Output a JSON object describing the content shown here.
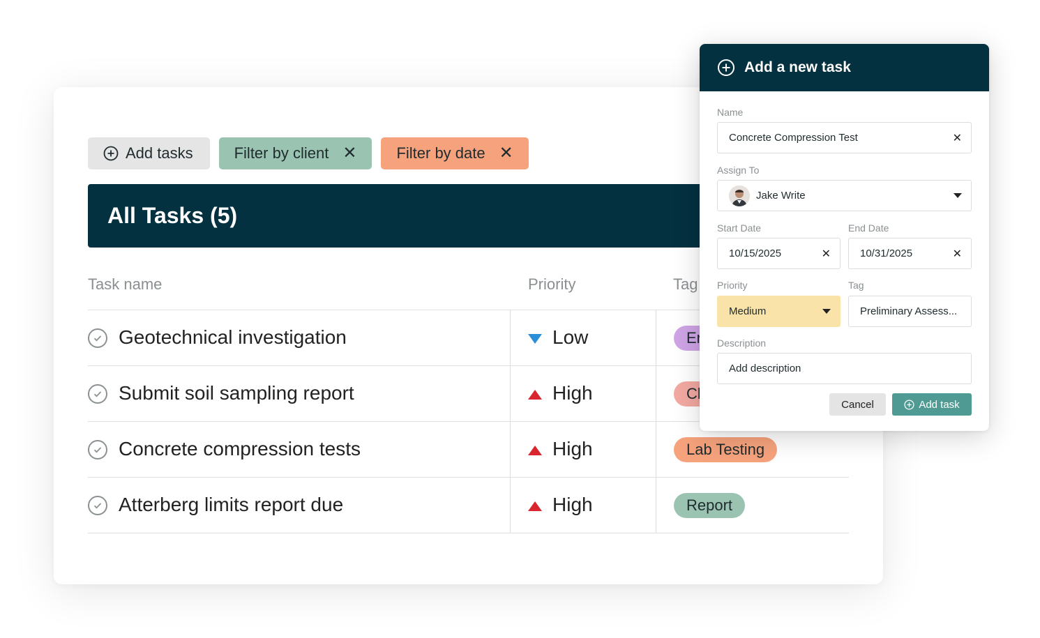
{
  "toolbar": {
    "add_tasks": "Add tasks",
    "filter_client": "Filter by client",
    "filter_date": "Filter by date",
    "remove_symbol": "✕"
  },
  "banner": {
    "title": "All Tasks (5)"
  },
  "columns": {
    "task_name": "Task name",
    "priority": "Priority",
    "tag": "Tag"
  },
  "rows": [
    {
      "name": "Geotechnical investigation",
      "priority": "Low",
      "priority_icon": "triangle-down-icon",
      "tag": "Er",
      "tag_color": "#cfa4e6"
    },
    {
      "name": "Submit soil sampling report",
      "priority": "High",
      "priority_icon": "triangle-up-icon",
      "tag": "Cl",
      "tag_color": "#f3a9a2"
    },
    {
      "name": "Concrete compression tests",
      "priority": "High",
      "priority_icon": "triangle-up-icon",
      "tag": "Lab Testing",
      "tag_color": "#f6a27c"
    },
    {
      "name": "Atterberg limits report due",
      "priority": "High",
      "priority_icon": "triangle-up-icon",
      "tag": "Report",
      "tag_color": "#9ac4b1"
    }
  ],
  "modal": {
    "title": "Add a new task",
    "name_label": "Name",
    "name_value": "Concrete Compression Test",
    "assign_label": "Assign To",
    "assign_value": "Jake Write",
    "start_label": "Start Date",
    "start_value": "10/15/2025",
    "end_label": "End Date",
    "end_value": "10/31/2025",
    "priority_label": "Priority",
    "priority_value": "Medium",
    "tag_label": "Tag",
    "tag_value": "Preliminary Assess...",
    "description_label": "Description",
    "description_value": "Add description",
    "cancel": "Cancel",
    "add_task": "Add task",
    "clear_symbol": "✕"
  },
  "colors": {
    "navy": "#043140",
    "teal": "#9ac4b1",
    "orange": "#f6a27c",
    "low_blue": "#2a8fd6",
    "high_red": "#d9262e",
    "medium_yellow": "#f9e3a8",
    "add_button": "#4f9a92"
  }
}
